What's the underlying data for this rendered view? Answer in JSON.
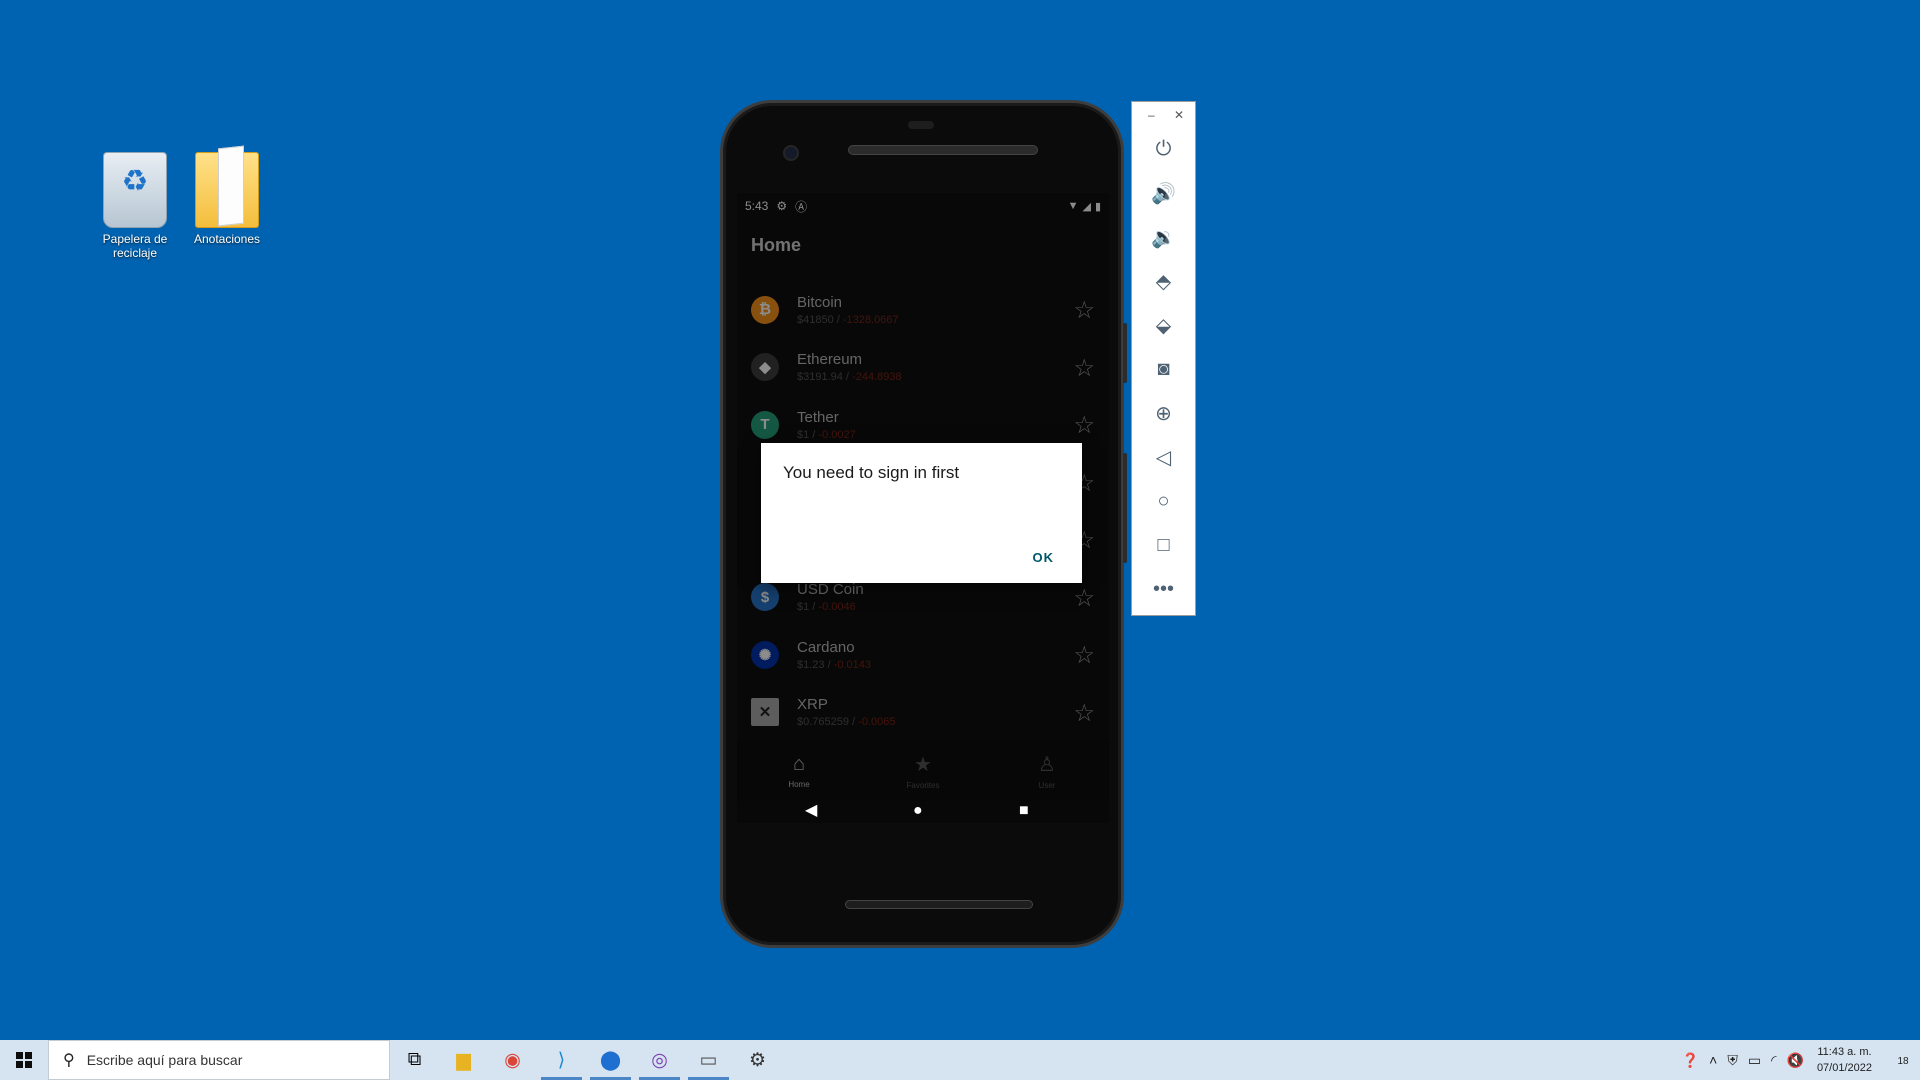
{
  "desktop": {
    "icons": [
      {
        "label": "Papelera de reciclaje",
        "icon": "recycle-bin-icon"
      },
      {
        "label": "Anotaciones",
        "icon": "folder-icon"
      }
    ]
  },
  "phone": {
    "status_bar": {
      "time": "5:43"
    },
    "app": {
      "title": "Home",
      "coins": [
        {
          "name": "Bitcoin",
          "price": "$41850 / ",
          "change": "-1328.0667",
          "logo_symbol": "₿",
          "logo_color": "#f7931a"
        },
        {
          "name": "Ethereum",
          "price": "$3191.94 / ",
          "change": "-244.8938",
          "logo_symbol": "◆",
          "logo_color": "#3c3c3d"
        },
        {
          "name": "Tether",
          "price": "$1 / ",
          "change": "-0.0027",
          "logo_symbol": "T",
          "logo_color": "#26a17b"
        },
        {
          "name": "USD Coin",
          "price": "$1 / ",
          "change": "-0.0046",
          "logo_symbol": "$",
          "logo_color": "#2775ca"
        },
        {
          "name": "Cardano",
          "price": "$1.23 / ",
          "change": "-0.0143",
          "logo_symbol": "✺",
          "logo_color": "#0033ad"
        },
        {
          "name": "XRP",
          "price": "$0.765259 / ",
          "change": "-0.0065",
          "logo_symbol": "✕",
          "logo_color": "#aaaaaa"
        }
      ],
      "bottom_nav": [
        {
          "label": "Home",
          "icon": "home-icon"
        },
        {
          "label": "Favorites",
          "icon": "star-icon"
        },
        {
          "label": "User",
          "icon": "user-icon"
        }
      ]
    },
    "dialog": {
      "message": "You need to sign in first",
      "ok_label": "OK"
    }
  },
  "emulator_toolbar": {
    "buttons": [
      "power-icon",
      "volume-up-icon",
      "volume-down-icon",
      "rotate-left-icon",
      "rotate-right-icon",
      "camera-icon",
      "zoom-icon",
      "back-icon",
      "home-icon",
      "overview-icon",
      "more-icon"
    ]
  },
  "taskbar": {
    "search_placeholder": "Escribe aquí para buscar",
    "clock_time": "11:43 a. m.",
    "clock_date": "07/01/2022",
    "notification_count": "18"
  },
  "colors": {
    "desktop_bg": "#0063b1",
    "change_negative": "#7a2619",
    "dialog_button": "#00576b"
  }
}
